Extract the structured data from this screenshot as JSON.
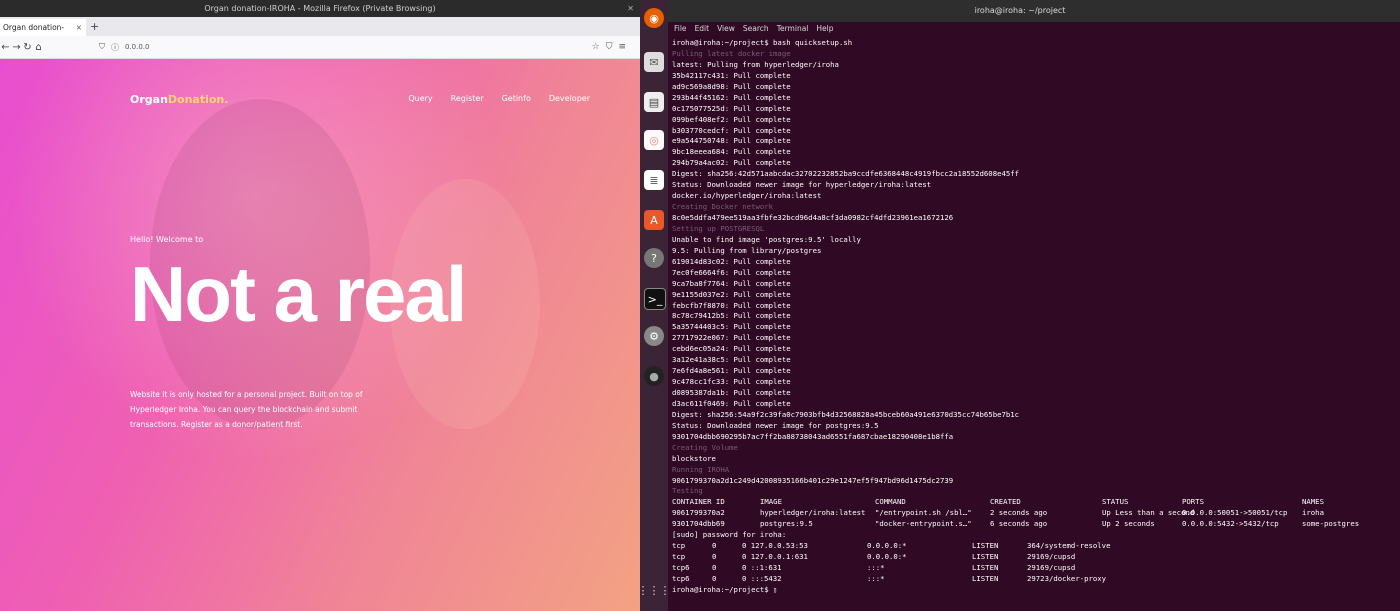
{
  "firefox": {
    "title": "Organ donation-IROHA - Mozilla Firefox (Private Browsing)",
    "tab_label": "Organ donation-IROHA",
    "url": "0.0.0.0",
    "site": {
      "brand_part1": "Organ",
      "brand_part2": "Donation.",
      "nav": [
        "Query",
        "Register",
        "Getinfo",
        "Developer"
      ],
      "hello": "Hello! Welcome to",
      "hero": "Not a real",
      "description": "Website it is only hosted for a personal project. Built on top of Hyperledger Iroha. You can query the blockchain and submit transactions. Register as a donor/patient first."
    }
  },
  "desktop": {
    "terminal_title": "iroha@iroha: ~/project"
  },
  "terminal": {
    "menu": [
      "File",
      "Edit",
      "View",
      "Search",
      "Terminal",
      "Help"
    ],
    "lines_top": [
      {
        "t": "iroha@iroha:~/project$ bash quicksetup.sh",
        "dim": false
      },
      {
        "t": "Pulling latest docker image",
        "dim": true
      },
      {
        "t": "latest: Pulling from hyperledger/iroha",
        "dim": false
      },
      {
        "t": "35b42117c431: Pull complete",
        "dim": false
      },
      {
        "t": "ad9c569a8d98: Pull complete",
        "dim": false
      },
      {
        "t": "293b44f45162: Pull complete",
        "dim": false
      },
      {
        "t": "0c175077525d: Pull complete",
        "dim": false
      },
      {
        "t": "099bef408ef2: Pull complete",
        "dim": false
      },
      {
        "t": "b303770cedcf: Pull complete",
        "dim": false
      },
      {
        "t": "e9a544750748: Pull complete",
        "dim": false
      },
      {
        "t": "9bc18eeea684: Pull complete",
        "dim": false
      },
      {
        "t": "294b79a4ac02: Pull complete",
        "dim": false
      },
      {
        "t": "Digest: sha256:42d571aabcdac32702232852ba9ccdfe6368448c4919fbcc2a18552d608e45ff",
        "dim": false
      },
      {
        "t": "Status: Downloaded newer image for hyperledger/iroha:latest",
        "dim": false
      },
      {
        "t": "docker.io/hyperledger/iroha:latest",
        "dim": false
      },
      {
        "t": "Creating Docker network",
        "dim": true
      },
      {
        "t": "8c0e5ddfa479ee519aa3fbfe32bcd96d4a8cf3da0982cf4dfd23961ea1672126",
        "dim": false
      },
      {
        "t": "Setting up POSTGRESQL",
        "dim": true
      },
      {
        "t": "Unable to find image 'postgres:9.5' locally",
        "dim": false
      },
      {
        "t": "9.5: Pulling from library/postgres",
        "dim": false
      },
      {
        "t": "619014d83c02: Pull complete",
        "dim": false
      },
      {
        "t": "7ec0fe6664f6: Pull complete",
        "dim": false
      },
      {
        "t": "9ca7ba8f7764: Pull complete",
        "dim": false
      },
      {
        "t": "9e1155d037e2: Pull complete",
        "dim": false
      },
      {
        "t": "febcfb7f8870: Pull complete",
        "dim": false
      },
      {
        "t": "8c78c79412b5: Pull complete",
        "dim": false
      },
      {
        "t": "5a35744403c5: Pull complete",
        "dim": false
      },
      {
        "t": "27717922e067: Pull complete",
        "dim": false
      },
      {
        "t": "cebd6ec05a24: Pull complete",
        "dim": false
      },
      {
        "t": "3a12e41a38c5: Pull complete",
        "dim": false
      },
      {
        "t": "7e6fd4a8e561: Pull complete",
        "dim": false
      },
      {
        "t": "9c478cc1fc33: Pull complete",
        "dim": false
      },
      {
        "t": "d0895387da1b: Pull complete",
        "dim": false
      },
      {
        "t": "d3ac611f0469: Pull complete",
        "dim": false
      },
      {
        "t": "Digest: sha256:54a9f2c39fa0c7903bfb4d32568828a45bceb60a491e6370d35cc74b65be7b1c",
        "dim": false
      },
      {
        "t": "Status: Downloaded newer image for postgres:9.5",
        "dim": false
      },
      {
        "t": "9301704dbb690295b7ac7ff2ba88738043ad6551fa687cbae18290408e1b8ffa",
        "dim": false
      },
      {
        "t": "Creating Volume",
        "dim": true
      },
      {
        "t": "blockstore",
        "dim": false
      },
      {
        "t": "Running IROHA",
        "dim": true
      },
      {
        "t": "9061799370a2d1c249d42008935166b401c29e1247ef5f947bd96d1475dc2739",
        "dim": false
      },
      {
        "t": "Testing",
        "dim": true
      }
    ],
    "ps_headers": [
      "CONTAINER ID",
      "IMAGE",
      "COMMAND",
      "CREATED",
      "STATUS",
      "PORTS",
      "NAMES"
    ],
    "ps_rows": [
      [
        "9061799370a2",
        "hyperledger/iroha:latest",
        "\"/entrypoint.sh /sbl…\"",
        "2 seconds ago",
        "Up Less than a second",
        "0.0.0.0:50051->50051/tcp",
        "iroha"
      ],
      [
        "9301704dbb69",
        "postgres:9.5",
        "\"docker-entrypoint.s…\"",
        "6 seconds ago",
        "Up 2 seconds",
        "0.0.0.0:5432->5432/tcp",
        "some-postgres"
      ]
    ],
    "sudo_prompt": "[sudo] password for iroha:",
    "net_rows": [
      [
        "tcp",
        "0",
        "0 127.0.0.53:53",
        "0.0.0.0:*",
        "LISTEN",
        "364/systemd-resolve"
      ],
      [
        "tcp",
        "0",
        "0 127.0.0.1:631",
        "0.0.0.0:*",
        "LISTEN",
        "29169/cupsd"
      ],
      [
        "tcp6",
        "0",
        "0 ::1:631",
        ":::*",
        "LISTEN",
        "29169/cupsd"
      ],
      [
        "tcp6",
        "0",
        "0 :::5432",
        ":::*",
        "LISTEN",
        "29723/docker-proxy"
      ]
    ],
    "final_prompt": "iroha@iroha:~/project$ "
  }
}
